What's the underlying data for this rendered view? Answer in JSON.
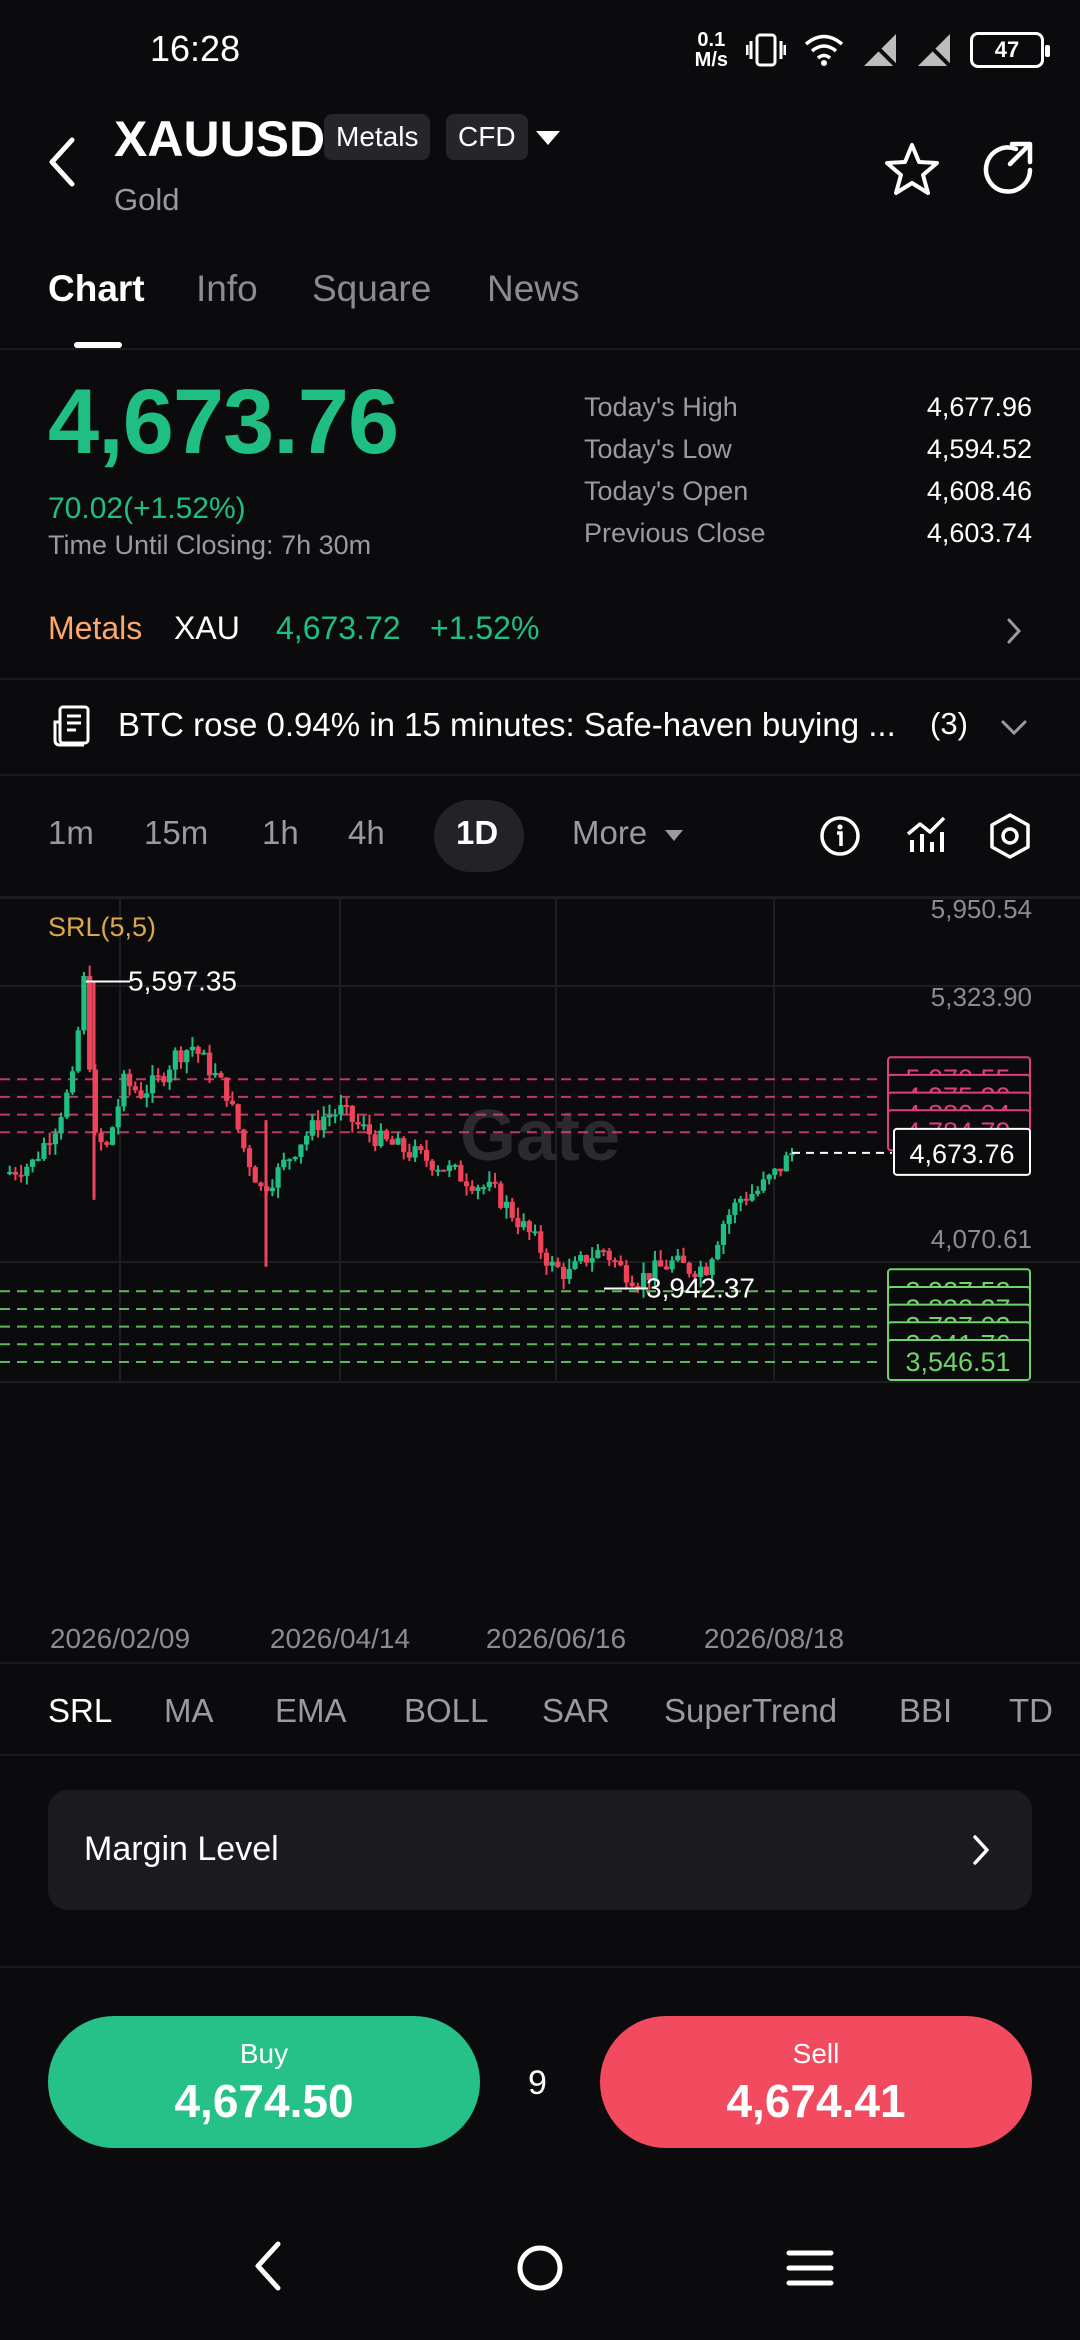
{
  "status_bar": {
    "time": "16:28",
    "speed_value": "0.1",
    "speed_unit": "M/s",
    "battery": "47",
    "icons": [
      "vibrate-icon",
      "wifi-icon",
      "no-signal-icon",
      "no-signal-icon",
      "battery-icon"
    ]
  },
  "header": {
    "symbol": "XAUUSD",
    "tags": [
      "Metals",
      "CFD"
    ],
    "subtitle": "Gold"
  },
  "tabs": [
    {
      "label": "Chart",
      "active": true
    },
    {
      "label": "Info"
    },
    {
      "label": "Square"
    },
    {
      "label": "News"
    }
  ],
  "quote": {
    "price": "4,673.76",
    "change": "70.02(+1.52%)",
    "closing_label": "Time Until Closing:",
    "closing_value": "7h 30m",
    "stats": [
      {
        "label": "Today's High",
        "value": "4,677.96"
      },
      {
        "label": "Today's Low",
        "value": "4,594.52"
      },
      {
        "label": "Today's Open",
        "value": "4,608.46"
      },
      {
        "label": "Previous Close",
        "value": "4,603.74"
      }
    ]
  },
  "metals_row": {
    "category": "Metals",
    "symbol": "XAU",
    "price": "4,673.72",
    "change": "+1.52%"
  },
  "news": {
    "headline": "BTC rose 0.94% in 15 minutes: Safe-haven buying ...",
    "count": "(3)"
  },
  "timeframes": {
    "items": [
      "1m",
      "15m",
      "1h",
      "4h"
    ],
    "active": "1D",
    "more": "More"
  },
  "indicators": {
    "items": [
      "SRL",
      "MA",
      "EMA",
      "BOLL",
      "SAR",
      "SuperTrend",
      "BBI",
      "TD"
    ],
    "active": "SRL"
  },
  "margin": {
    "label": "Margin Level"
  },
  "trade": {
    "buy_label": "Buy",
    "buy_price": "4,674.50",
    "sell_label": "Sell",
    "sell_price": "4,674.41",
    "spread": "9"
  },
  "colors": {
    "up": "#1fbf84",
    "down": "#f0435a",
    "resistance": "#e0407a",
    "support": "#6fd46a",
    "accent_orange": "#ffa86b"
  },
  "chart_data": {
    "type": "candlestick",
    "indicator_label": "SRL(5,5)",
    "y_axis_labels": [
      "5,950.54",
      "5,323.90",
      "4,070.61"
    ],
    "x_axis_labels": [
      "2026/02/09",
      "2026/04/14",
      "2026/06/16",
      "2026/08/18"
    ],
    "watermark": "Gate",
    "high_marker": "5,597.35",
    "low_marker": "3,942.37",
    "last_price": "4,673.76",
    "resistance_levels": [
      "5,070.55",
      "4,975.30",
      "4,880.04",
      "4,784.79"
    ],
    "support_levels": [
      "3,927.52",
      "3,832.27",
      "3,737.02",
      "3,641.76",
      "3,546.51"
    ],
    "ylim": [
      3460,
      5950.54
    ],
    "price_path": [
      [
        0,
        4560
      ],
      [
        5,
        4620
      ],
      [
        9,
        4820
      ],
      [
        12,
        5060
      ],
      [
        14,
        5597.35
      ],
      [
        16,
        4740
      ],
      [
        18,
        4700
      ],
      [
        21,
        5050
      ],
      [
        24,
        5000
      ],
      [
        27,
        5060
      ],
      [
        30,
        5200
      ],
      [
        33,
        5250
      ],
      [
        36,
        5130
      ],
      [
        39,
        5000
      ],
      [
        42,
        4700
      ],
      [
        45,
        4480
      ],
      [
        48,
        4570
      ],
      [
        52,
        4740
      ],
      [
        56,
        4870
      ],
      [
        59,
        4900
      ],
      [
        62,
        4820
      ],
      [
        66,
        4740
      ],
      [
        70,
        4690
      ],
      [
        74,
        4640
      ],
      [
        78,
        4580
      ],
      [
        82,
        4520
      ],
      [
        86,
        4460
      ],
      [
        90,
        4310
      ],
      [
        93,
        4200
      ],
      [
        96,
        4060
      ],
      [
        99,
        4020
      ],
      [
        102,
        4110
      ],
      [
        105,
        4150
      ],
      [
        108,
        4050
      ],
      [
        111,
        3990
      ],
      [
        114,
        4040
      ],
      [
        117,
        4080
      ],
      [
        120,
        4050
      ],
      [
        123,
        4060
      ],
      [
        126,
        4300
      ],
      [
        129,
        4430
      ],
      [
        132,
        4470
      ],
      [
        135,
        4560
      ],
      [
        138,
        4673.76
      ]
    ]
  }
}
